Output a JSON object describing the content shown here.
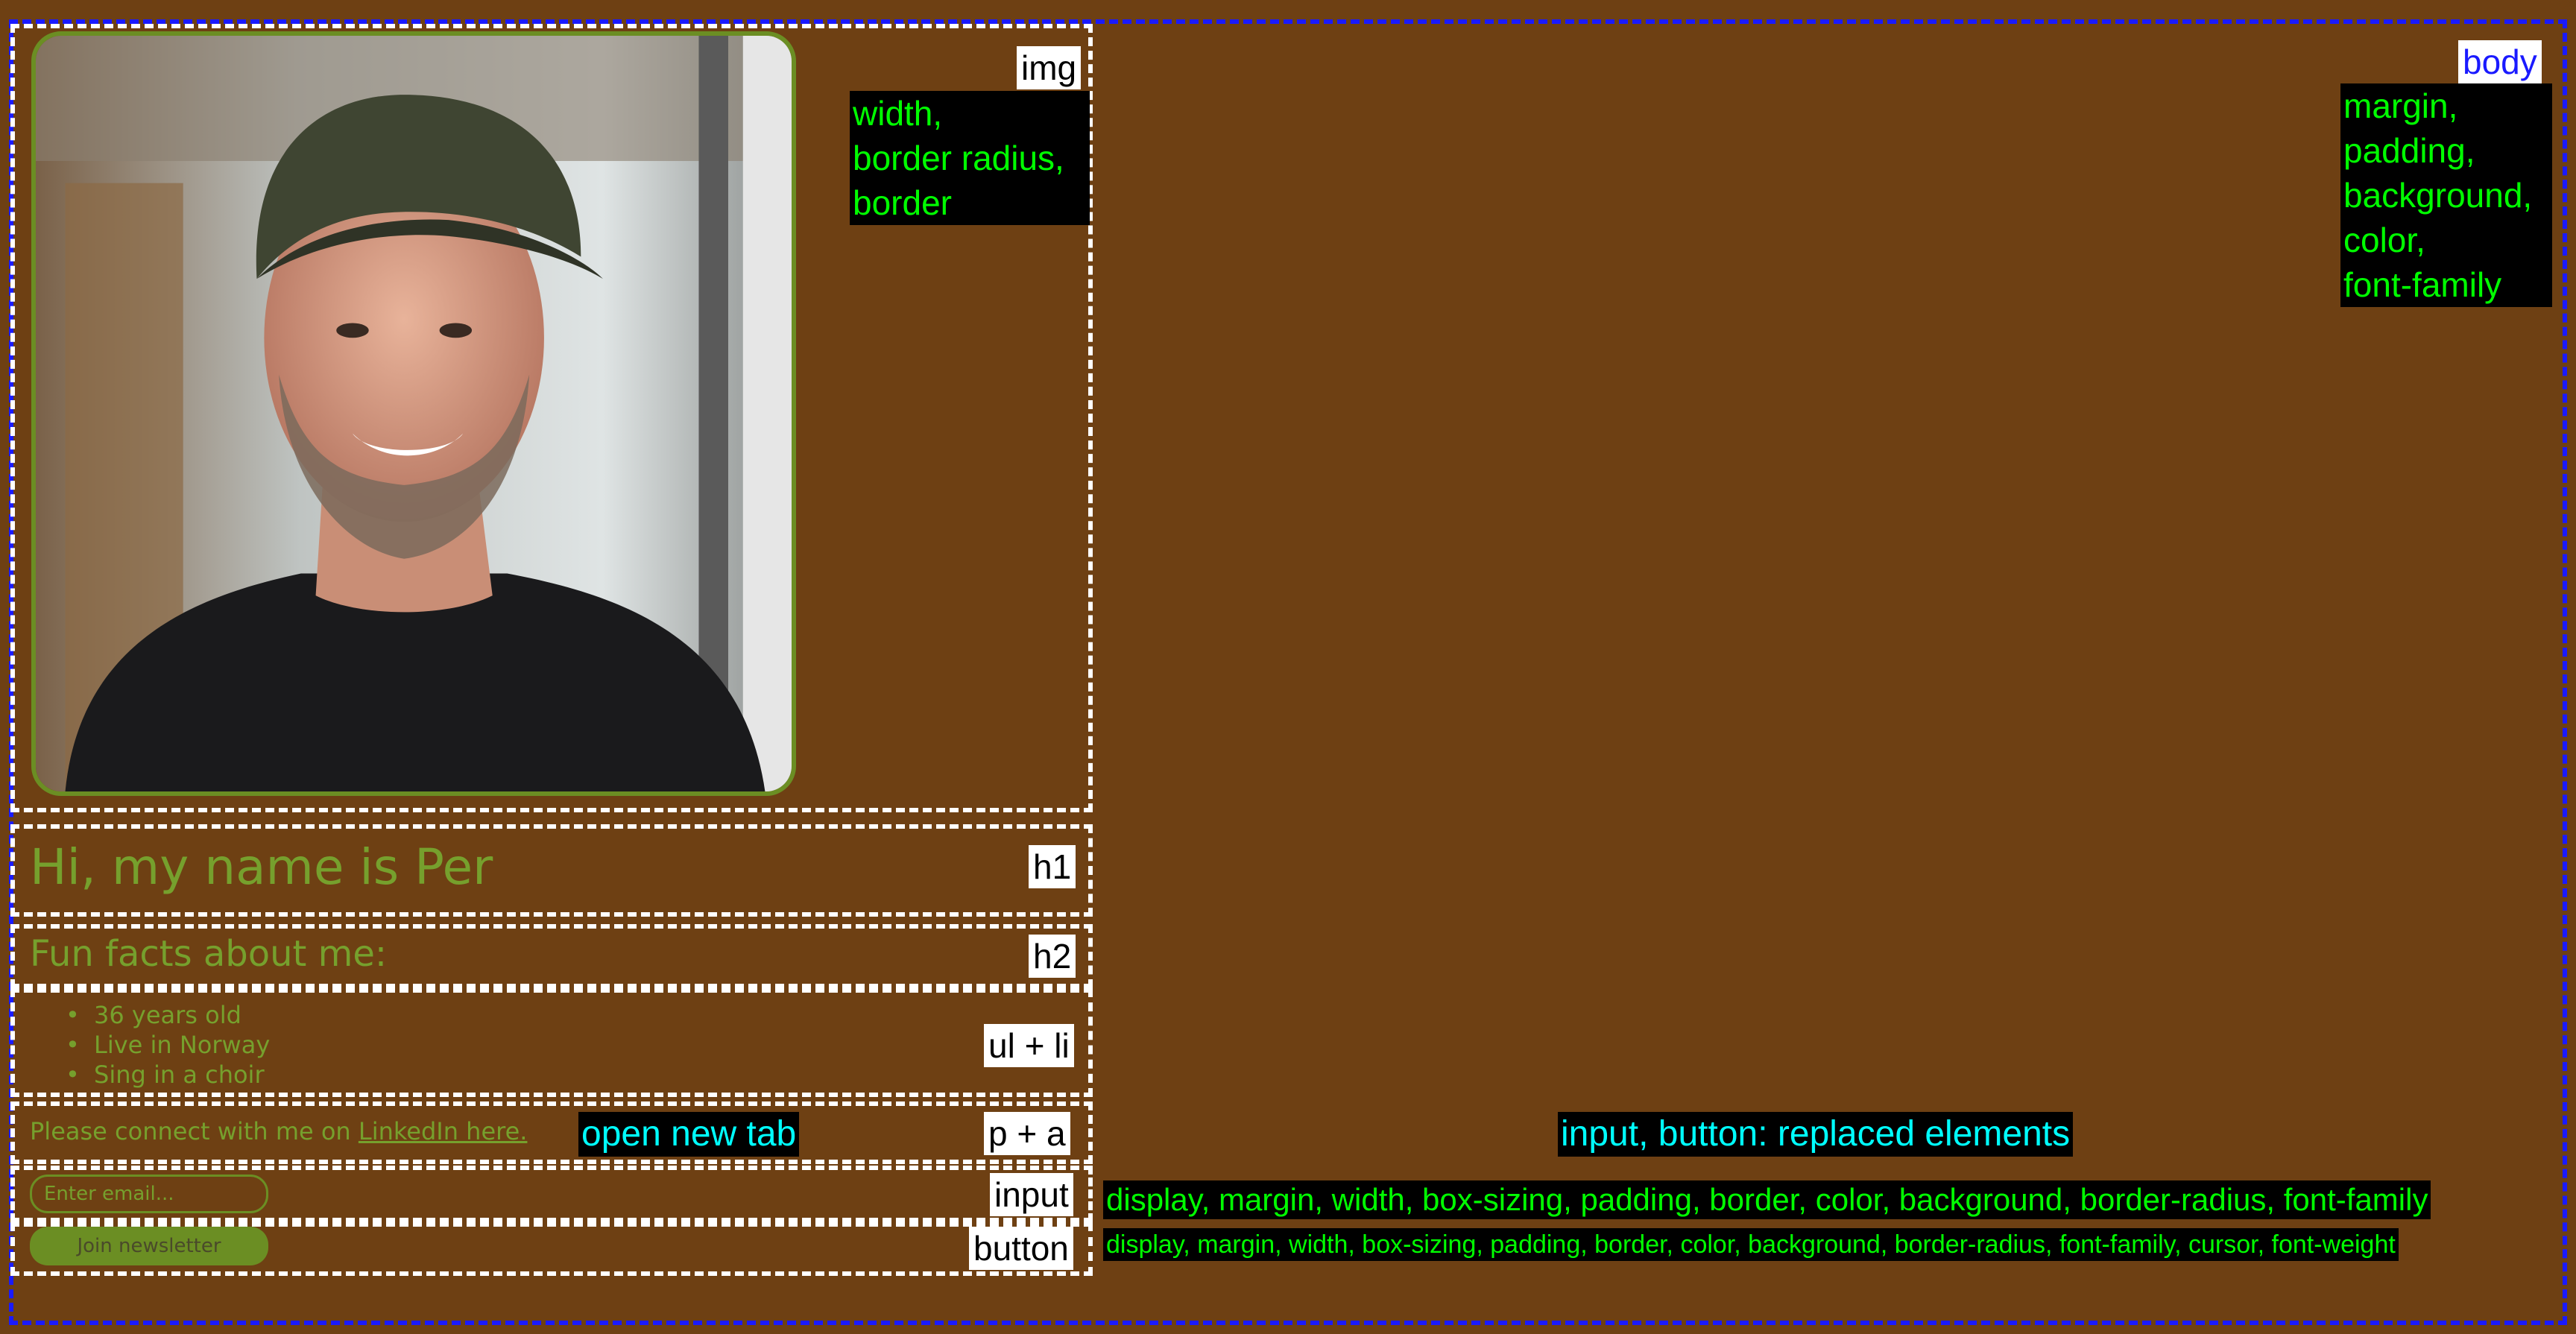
{
  "labels": {
    "img": "img",
    "body": "body",
    "h1": "h1",
    "h2": "h2",
    "ul_li": "ul + li",
    "p_a": "p + a",
    "input": "input",
    "button": "button"
  },
  "annotations": {
    "img_props": [
      "width,",
      "border radius,",
      "border"
    ],
    "body_props": [
      "margin,",
      "padding,",
      "background,",
      "color,",
      "font-family"
    ],
    "open_new_tab": "open new tab",
    "replaced_elements": "input, button: replaced elements",
    "input_props": "display, margin, width, box-sizing, padding, border, color, background, border-radius, font-family",
    "button_props": "display, margin, width, box-sizing, padding, border, color, background, border-radius, font-family, cursor, font-weight"
  },
  "profile": {
    "heading": "Hi, my name is Per",
    "subheading": "Fun facts about me:",
    "facts": [
      "36 years old",
      "Live in Norway",
      "Sing in a choir"
    ],
    "connect_text": "Please connect with me on ",
    "link_text": "LinkedIn here.",
    "email_placeholder": "Enter email...",
    "button_label": "Join newsletter"
  },
  "colors": {
    "background": "#6e4013",
    "accent": "#6b8e23",
    "body_outline": "#1a1aff",
    "element_outline": "#ffffff",
    "property_text": "#00ff00",
    "note_text": "#00ffff"
  },
  "icons": {
    "photo": "profile-photo"
  }
}
